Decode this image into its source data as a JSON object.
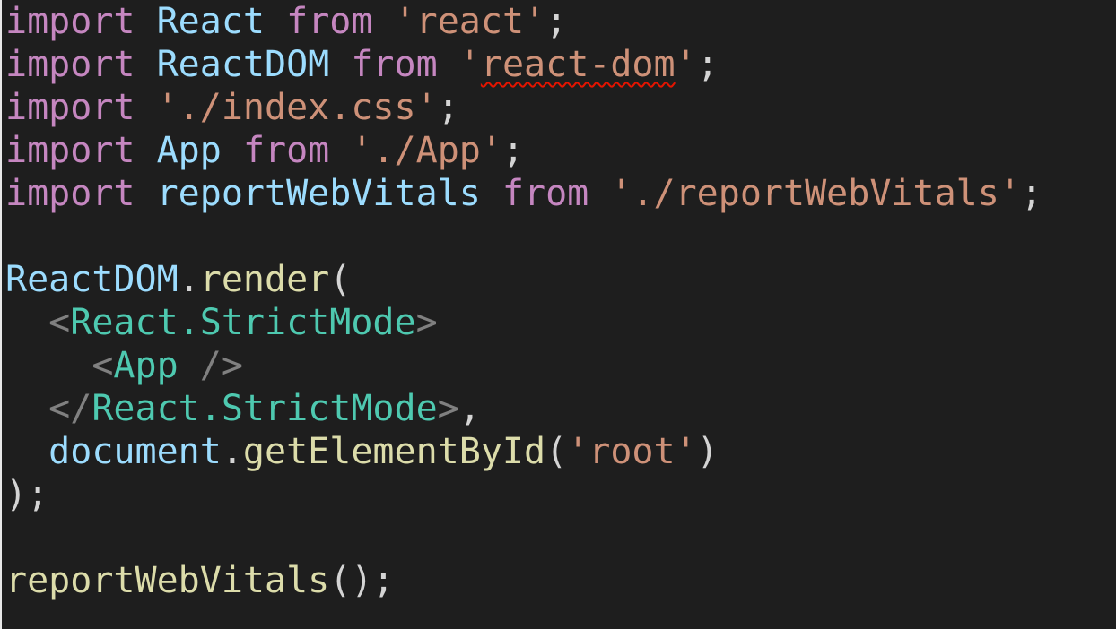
{
  "editor": {
    "lines": [
      [
        {
          "t": "import",
          "k": "kw"
        },
        {
          "t": " ",
          "k": "pun"
        },
        {
          "t": "React",
          "k": "var"
        },
        {
          "t": " ",
          "k": "pun"
        },
        {
          "t": "from",
          "k": "kw"
        },
        {
          "t": " ",
          "k": "pun"
        },
        {
          "t": "'react'",
          "k": "str"
        },
        {
          "t": ";",
          "k": "pun"
        }
      ],
      [
        {
          "t": "import",
          "k": "kw"
        },
        {
          "t": " ",
          "k": "pun"
        },
        {
          "t": "ReactDOM",
          "k": "var"
        },
        {
          "t": " ",
          "k": "pun"
        },
        {
          "t": "from",
          "k": "kw"
        },
        {
          "t": " ",
          "k": "pun"
        },
        {
          "t": "'",
          "k": "str"
        },
        {
          "t": "react-dom",
          "k": "str",
          "sq": true
        },
        {
          "t": "'",
          "k": "str"
        },
        {
          "t": ";",
          "k": "pun"
        }
      ],
      [
        {
          "t": "import",
          "k": "kw"
        },
        {
          "t": " ",
          "k": "pun"
        },
        {
          "t": "'./index.css'",
          "k": "str"
        },
        {
          "t": ";",
          "k": "pun"
        }
      ],
      [
        {
          "t": "import",
          "k": "kw"
        },
        {
          "t": " ",
          "k": "pun"
        },
        {
          "t": "App",
          "k": "var"
        },
        {
          "t": " ",
          "k": "pun"
        },
        {
          "t": "from",
          "k": "kw"
        },
        {
          "t": " ",
          "k": "pun"
        },
        {
          "t": "'./App'",
          "k": "str"
        },
        {
          "t": ";",
          "k": "pun"
        }
      ],
      [
        {
          "t": "import",
          "k": "kw"
        },
        {
          "t": " ",
          "k": "pun"
        },
        {
          "t": "reportWebVitals",
          "k": "var"
        },
        {
          "t": " ",
          "k": "pun"
        },
        {
          "t": "from",
          "k": "kw"
        },
        {
          "t": " ",
          "k": "pun"
        },
        {
          "t": "'./reportWebVitals'",
          "k": "str"
        },
        {
          "t": ";",
          "k": "pun"
        }
      ],
      [],
      [
        {
          "t": "ReactDOM",
          "k": "var"
        },
        {
          "t": ".",
          "k": "pun"
        },
        {
          "t": "render",
          "k": "fn"
        },
        {
          "t": "(",
          "k": "pun"
        }
      ],
      [
        {
          "t": "  ",
          "k": "pun"
        },
        {
          "t": "<",
          "k": "ang"
        },
        {
          "t": "React.StrictMode",
          "k": "tag"
        },
        {
          "t": ">",
          "k": "ang"
        }
      ],
      [
        {
          "t": "    ",
          "k": "pun"
        },
        {
          "t": "<",
          "k": "ang"
        },
        {
          "t": "App",
          "k": "tag"
        },
        {
          "t": " />",
          "k": "ang"
        }
      ],
      [
        {
          "t": "  ",
          "k": "pun"
        },
        {
          "t": "</",
          "k": "ang"
        },
        {
          "t": "React.StrictMode",
          "k": "tag"
        },
        {
          "t": ">",
          "k": "ang"
        },
        {
          "t": ",",
          "k": "pun"
        }
      ],
      [
        {
          "t": "  ",
          "k": "pun"
        },
        {
          "t": "document",
          "k": "var"
        },
        {
          "t": ".",
          "k": "pun"
        },
        {
          "t": "getElementById",
          "k": "fn"
        },
        {
          "t": "(",
          "k": "pun"
        },
        {
          "t": "'root'",
          "k": "str"
        },
        {
          "t": ")",
          "k": "pun"
        }
      ],
      [
        {
          "t": ");",
          "k": "pun"
        }
      ],
      [],
      [
        {
          "t": "reportWebVitals",
          "k": "fn"
        },
        {
          "t": "();",
          "k": "pun"
        }
      ]
    ]
  }
}
